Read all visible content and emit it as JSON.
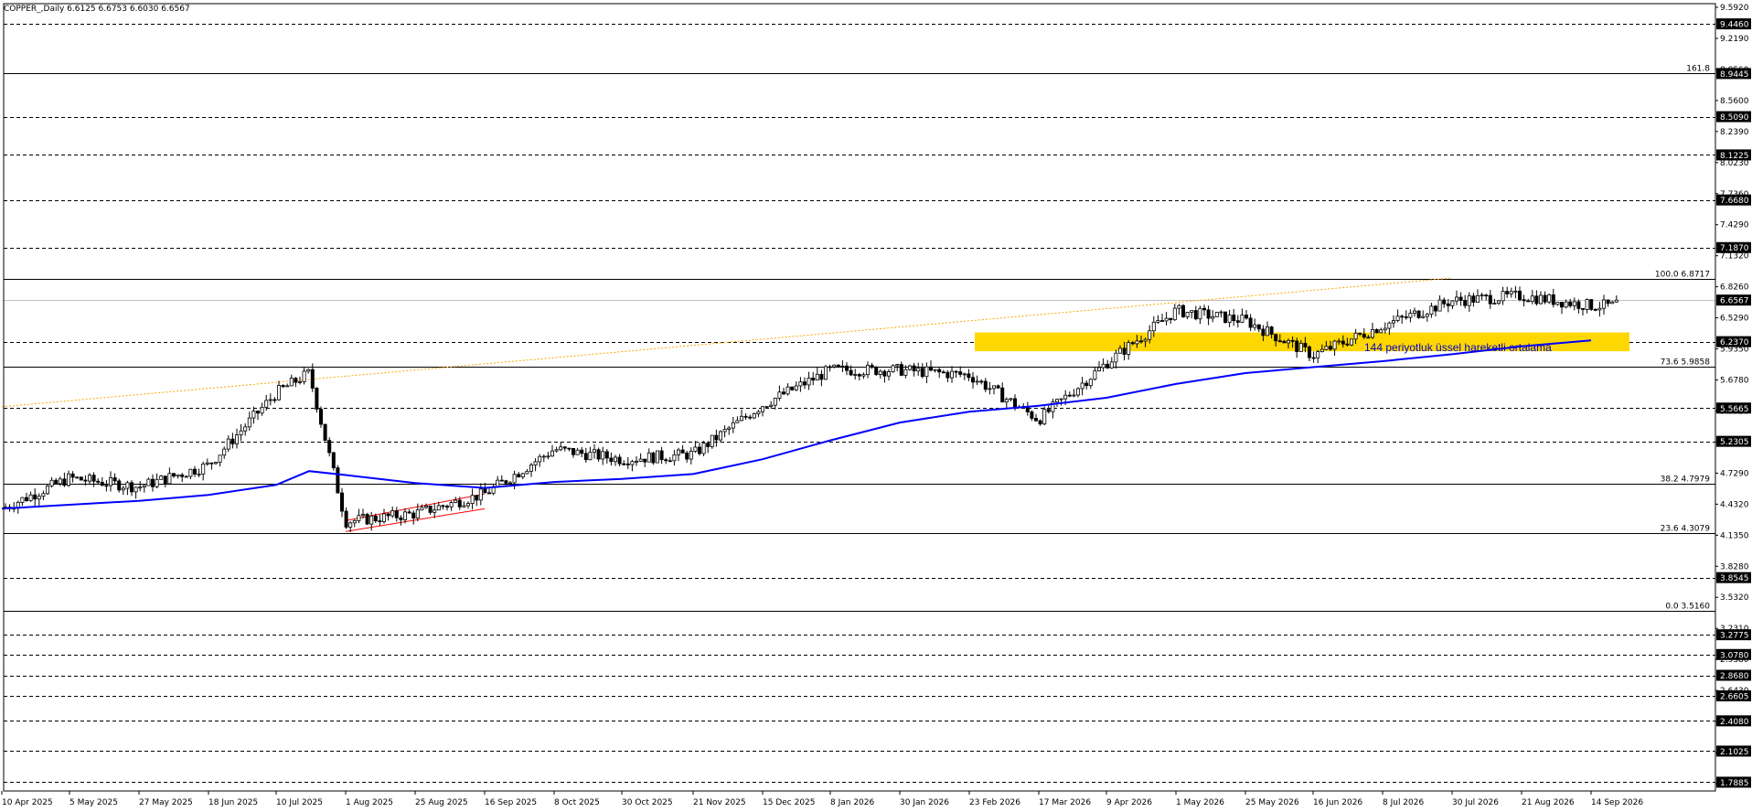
{
  "header": {
    "text": "COPPER_,Daily  6.6125 6.6753 6.6030 6.6567"
  },
  "colors": {
    "background": "#ffffff",
    "frame": "#000000",
    "candle_up": "#ffffff",
    "candle_down": "#000000",
    "ema": "#0000ff",
    "zone": "#ffd700",
    "trendline": "#ffa500",
    "channel": "#ff0000",
    "badge": "#000000",
    "badge_text": "#ffffff",
    "note": "#0000cc"
  },
  "chart_data": {
    "type": "candlestick",
    "title": "COPPER_,Daily",
    "ohlc_last": {
      "open": 6.6125,
      "high": 6.6753,
      "low": 6.603,
      "close": 6.6567
    },
    "ylim": [
      1.7,
      9.65
    ],
    "x_ticks": [
      "10 Apr 2025",
      "5 May 2025",
      "27 May 2025",
      "18 Jun 2025",
      "10 Jul 2025",
      "1 Aug 2025",
      "25 Aug 2025",
      "16 Sep 2025",
      "8 Oct 2025",
      "30 Oct 2025",
      "21 Nov 2025",
      "15 Dec 2025",
      "8 Jan 2026",
      "30 Jan 2026",
      "23 Feb 2026",
      "17 Mar 2026",
      "9 Apr 2026",
      "1 May 2026",
      "25 May 2026",
      "16 Jun 2026",
      "8 Jul 2026",
      "30 Jul 2026",
      "21 Aug 2026",
      "14 Sep 2026"
    ],
    "y_ticks": [
      "9.5920",
      "9.2190",
      "8.8560",
      "8.5600",
      "8.2390",
      "8.0230",
      "7.7360",
      "7.4290",
      "7.1320",
      "6.8260",
      "6.5290",
      "5.9350",
      "5.6780",
      "5.3320",
      "5.0350",
      "4.7290",
      "4.4320",
      "4.1350",
      "3.8280",
      "3.5320",
      "3.2310",
      "2.9380",
      "2.6430",
      "2.3350",
      "2.0350",
      "1.7410"
    ],
    "levels": [
      {
        "value": 9.446,
        "label": "9.4460",
        "style": "dashed"
      },
      {
        "value": 8.9445,
        "label": "8.9445",
        "style": "solid",
        "fib": "161.8"
      },
      {
        "value": 8.509,
        "label": "8.5090",
        "style": "dashed"
      },
      {
        "value": 8.1225,
        "label": "8.1225",
        "style": "dashed"
      },
      {
        "value": 7.668,
        "label": "7.6680",
        "style": "dashed"
      },
      {
        "value": 7.187,
        "label": "7.1870",
        "style": "dashed"
      },
      {
        "value": 6.8717,
        "label": "",
        "style": "solid",
        "fib": "100.0 6.8717"
      },
      {
        "value": 6.237,
        "label": "6.2370",
        "style": "dashed"
      },
      {
        "value": 5.9858,
        "label": "",
        "style": "solid",
        "fib": "73.6 5.9858"
      },
      {
        "value": 5.5665,
        "label": "5.5665",
        "style": "dashed"
      },
      {
        "value": 5.2305,
        "label": "5.2305",
        "style": "dashed"
      },
      {
        "value": 4.7979,
        "label": "",
        "style": "solid",
        "fib": "38.2 4.7979"
      },
      {
        "value": 4.3079,
        "label": "",
        "style": "solid",
        "fib": "23.6 4.3079"
      },
      {
        "value": 3.8545,
        "label": "3.8545",
        "style": "dashed"
      },
      {
        "value": 3.516,
        "label": "",
        "style": "solid",
        "fib": "0.0 3.5160"
      },
      {
        "value": 3.2775,
        "label": "3.2775",
        "style": "dashed"
      },
      {
        "value": 3.078,
        "label": "3.0780",
        "style": "dashed"
      },
      {
        "value": 2.868,
        "label": "2.8680",
        "style": "dashed"
      },
      {
        "value": 2.6605,
        "label": "2.6605",
        "style": "dashed"
      },
      {
        "value": 2.408,
        "label": "2.4080",
        "style": "dashed"
      },
      {
        "value": 2.1025,
        "label": "2.1025",
        "style": "dashed"
      },
      {
        "value": 1.7885,
        "label": "1.7885",
        "style": "dashed"
      }
    ],
    "current_price": {
      "value": 6.6567,
      "label": "6.6567"
    },
    "zone": {
      "x_from": "9 Apr 2026",
      "x_to": "beyond 14 Sep 2026",
      "y_from": 6.14,
      "y_to": 6.33
    },
    "ema_label": "144 periyotluk üssel hareketli ortalama",
    "ema_points": [
      [
        "10 Apr 2025",
        4.55
      ],
      [
        "5 May 2025",
        4.59
      ],
      [
        "27 May 2025",
        4.63
      ],
      [
        "18 Jun 2025",
        4.69
      ],
      [
        "10 Jul 2025",
        4.79
      ],
      [
        "20 Jul 2025",
        4.93
      ],
      [
        "1 Aug 2025",
        4.89
      ],
      [
        "25 Aug 2025",
        4.81
      ],
      [
        "16 Sep 2025",
        4.76
      ],
      [
        "8 Oct 2025",
        4.82
      ],
      [
        "30 Oct 2025",
        4.85
      ],
      [
        "21 Nov 2025",
        4.9
      ],
      [
        "15 Dec 2025",
        5.05
      ],
      [
        "8 Jan 2026",
        5.24
      ],
      [
        "30 Jan 2026",
        5.42
      ],
      [
        "23 Feb 2026",
        5.53
      ],
      [
        "17 Mar 2026",
        5.59
      ],
      [
        "9 Apr 2026",
        5.67
      ],
      [
        "1 May 2026",
        5.81
      ],
      [
        "25 May 2026",
        5.92
      ],
      [
        "16 Jun 2026",
        5.98
      ],
      [
        "8 Jul 2026",
        6.04
      ],
      [
        "30 Jul 2026",
        6.11
      ],
      [
        "21 Aug 2026",
        6.19
      ],
      [
        "14 Sep 2026",
        6.25
      ]
    ],
    "trendline": {
      "from": [
        "10 Apr 2025",
        5.58
      ],
      "to": [
        "30 Jul 2026",
        6.88
      ]
    },
    "channel": {
      "lower": [
        [
          "1 Aug 2025",
          4.32
        ],
        [
          "16 Sep 2025",
          4.55
        ]
      ],
      "upper": [
        [
          "1 Aug 2025",
          4.43
        ],
        [
          "16 Sep 2025",
          4.7
        ]
      ]
    },
    "price_path": [
      [
        "10 Apr 2025",
        4.55
      ],
      [
        "5 May 2025",
        4.86
      ],
      [
        "27 May 2025",
        4.77
      ],
      [
        "18 Jun 2025",
        4.99
      ],
      [
        "10 Jul 2025",
        5.72
      ],
      [
        "20 Jul 2025",
        5.92
      ],
      [
        "1 Aug 2025",
        4.42
      ],
      [
        "25 Aug 2025",
        4.5
      ],
      [
        "16 Sep 2025",
        4.7
      ],
      [
        "8 Oct 2025",
        5.15
      ],
      [
        "30 Oct 2025",
        5.05
      ],
      [
        "21 Nov 2025",
        5.1
      ],
      [
        "15 Dec 2025",
        5.6
      ],
      [
        "8 Jan 2026",
        5.95
      ],
      [
        "30 Jan 2026",
        5.95
      ],
      [
        "23 Feb 2026",
        5.9
      ],
      [
        "17 Mar 2026",
        5.45
      ],
      [
        "9 Apr 2026",
        6.02
      ],
      [
        "1 May 2026",
        6.55
      ],
      [
        "25 May 2026",
        6.45
      ],
      [
        "16 Jun 2026",
        6.1
      ],
      [
        "8 Jul 2026",
        6.4
      ],
      [
        "30 Jul 2026",
        6.65
      ],
      [
        "21 Aug 2026",
        6.7
      ],
      [
        "14 Sep 2026",
        6.6
      ]
    ]
  }
}
